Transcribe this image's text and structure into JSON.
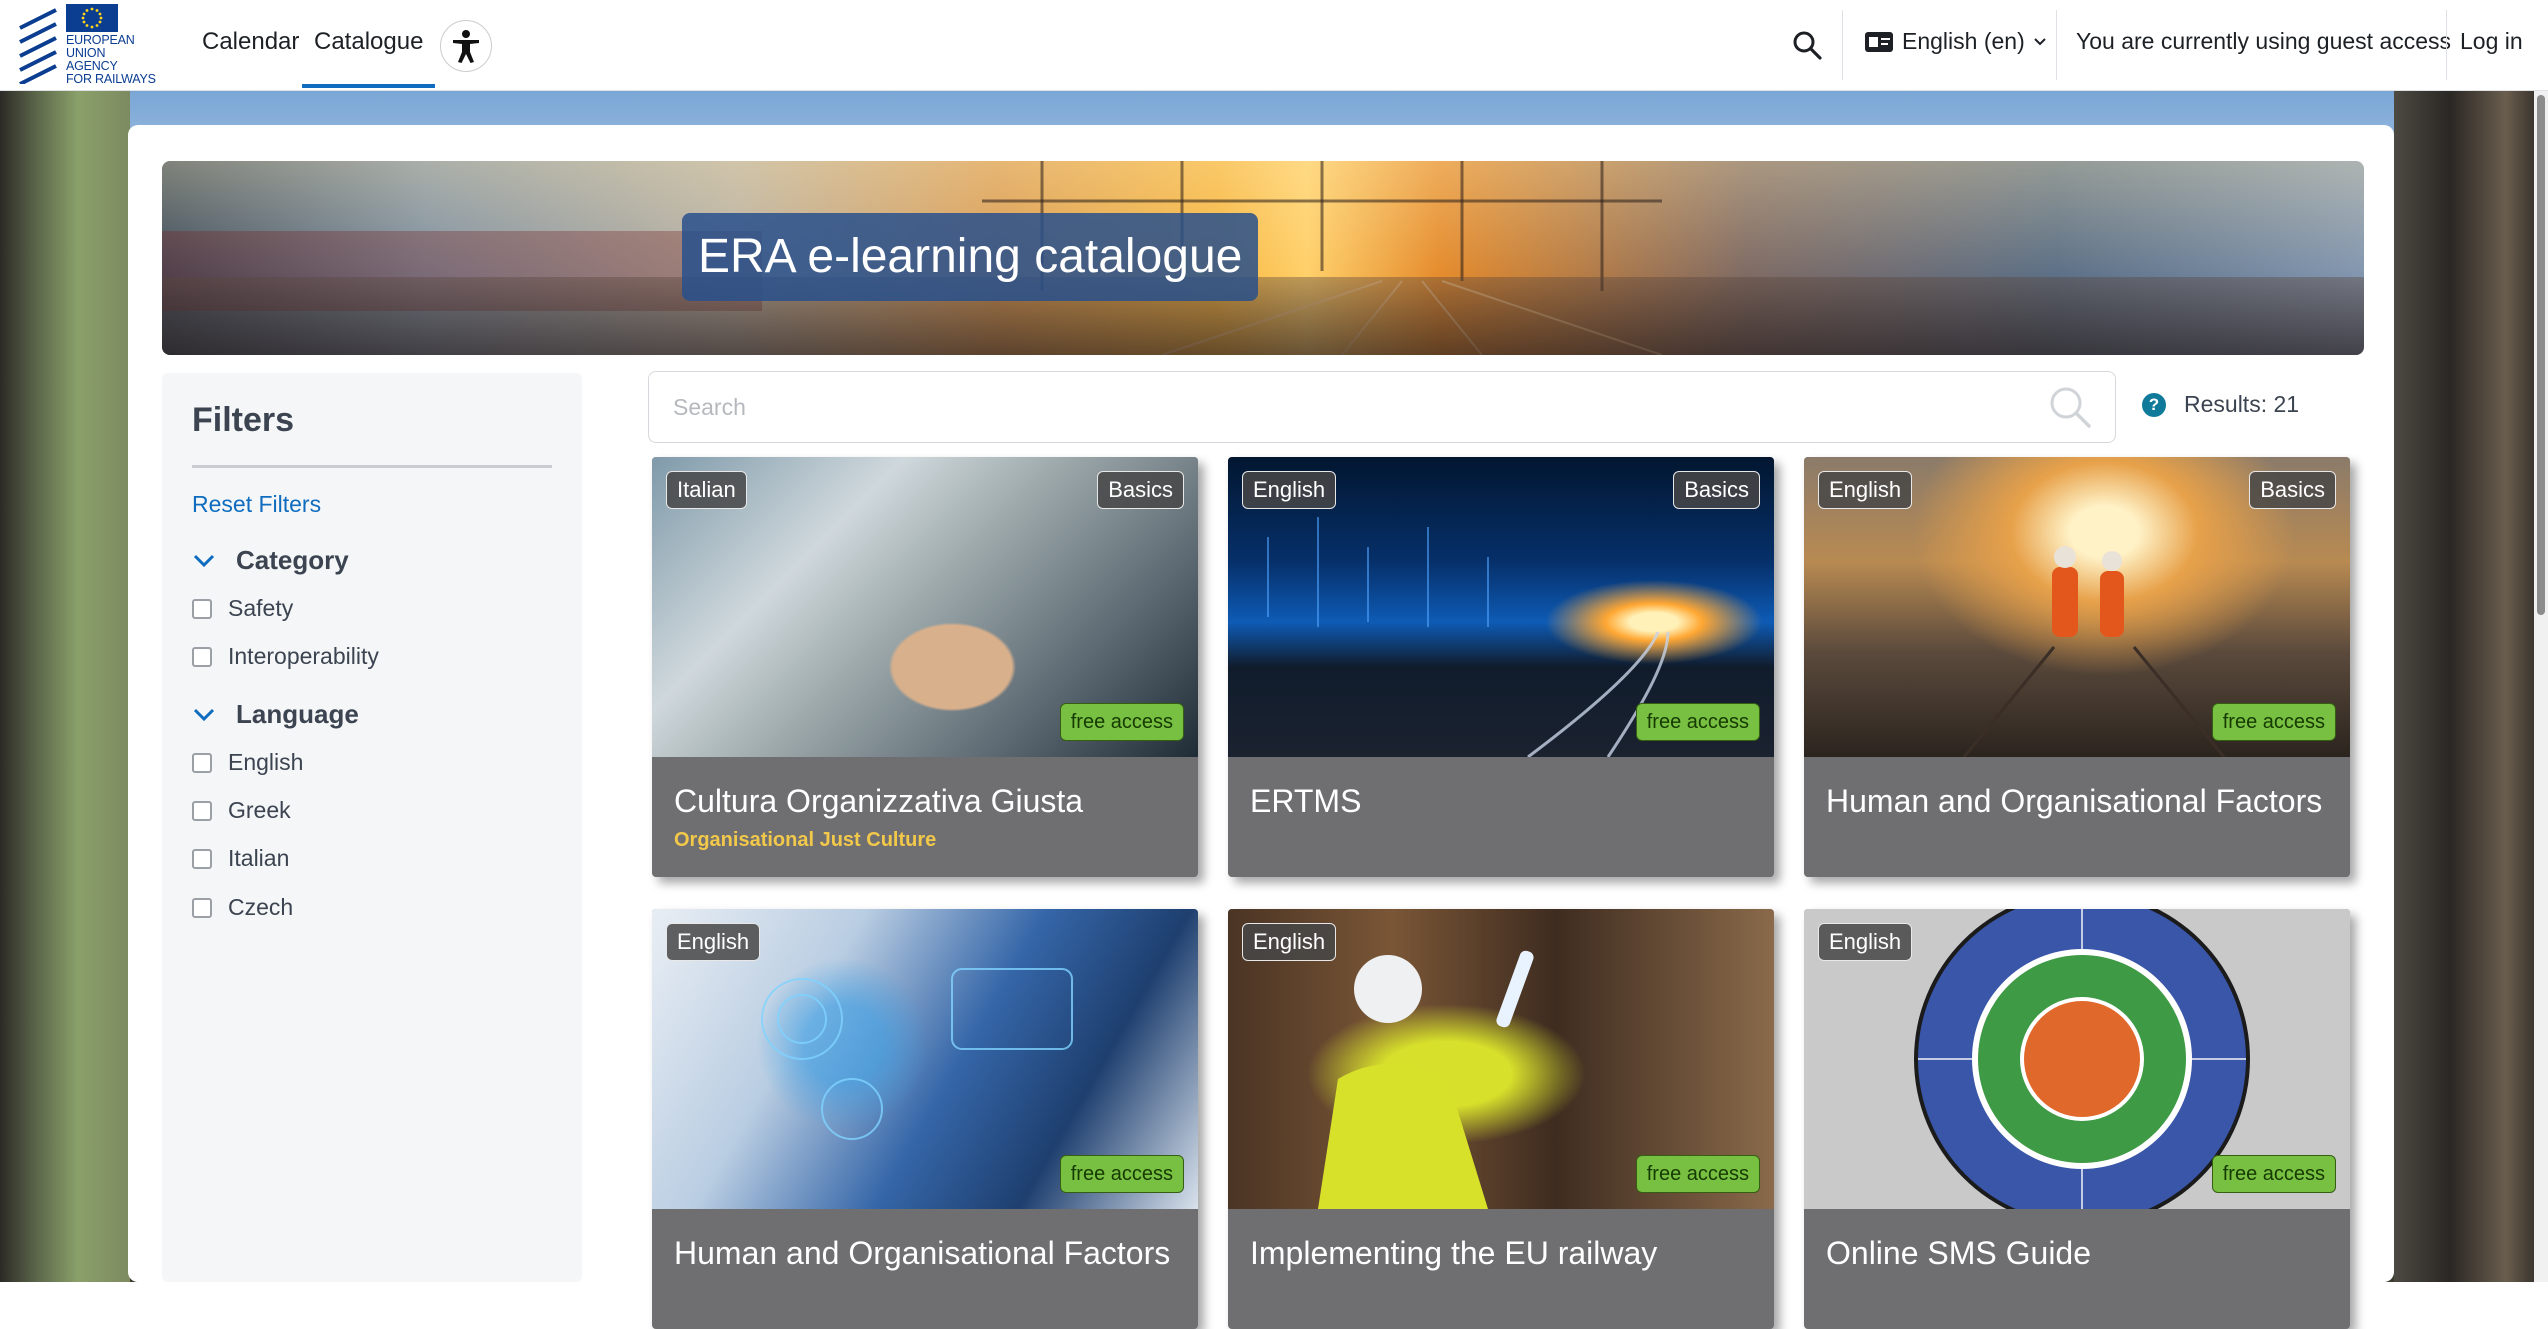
{
  "nav": {
    "logo_text": [
      "EUROPEAN",
      "UNION",
      "AGENCY",
      "FOR RAILWAYS"
    ],
    "links": [
      {
        "label": "Calendar",
        "active": false
      },
      {
        "label": "Catalogue",
        "active": true
      }
    ],
    "accessibility_icon": "accessibility-icon",
    "search_icon": "search-icon",
    "language": "English ‎(en)‎",
    "language_icon": "language-card-icon",
    "guest_text": "You are currently using guest access",
    "login": "Log in"
  },
  "hero": {
    "title": "ERA e-learning catalogue"
  },
  "filters": {
    "title": "Filters",
    "reset": "Reset Filters",
    "groups": [
      {
        "label": "Category",
        "options": [
          "Safety",
          "Interoperability"
        ]
      },
      {
        "label": "Language",
        "options": [
          "English",
          "Greek",
          "Italian",
          "Czech"
        ]
      }
    ]
  },
  "search": {
    "placeholder": "Search",
    "value": ""
  },
  "results_label": "Results: 21",
  "colors": {
    "accent": "#0f6cbf",
    "free_badge": "#78c042",
    "card_body": "#6f6f71",
    "subtitle": "#f2c84b"
  },
  "courses": [
    {
      "language": "Italian",
      "level": "Basics",
      "access": "free access",
      "title": "Cultura Organizzativa Giusta",
      "subtitle": "Organisational Just Culture"
    },
    {
      "language": "English",
      "level": "Basics",
      "access": "free access",
      "title": "ERTMS",
      "subtitle": ""
    },
    {
      "language": "English",
      "level": "Basics",
      "access": "free access",
      "title": "Human and Organisational Factors",
      "subtitle": ""
    },
    {
      "language": "English",
      "level": "",
      "access": "free access",
      "title": "Human and Organisational Factors",
      "subtitle": ""
    },
    {
      "language": "English",
      "level": "",
      "access": "free access",
      "title": "Implementing the EU railway",
      "subtitle": ""
    },
    {
      "language": "English",
      "level": "",
      "access": "free access",
      "title": "Online SMS Guide",
      "subtitle": ""
    }
  ]
}
